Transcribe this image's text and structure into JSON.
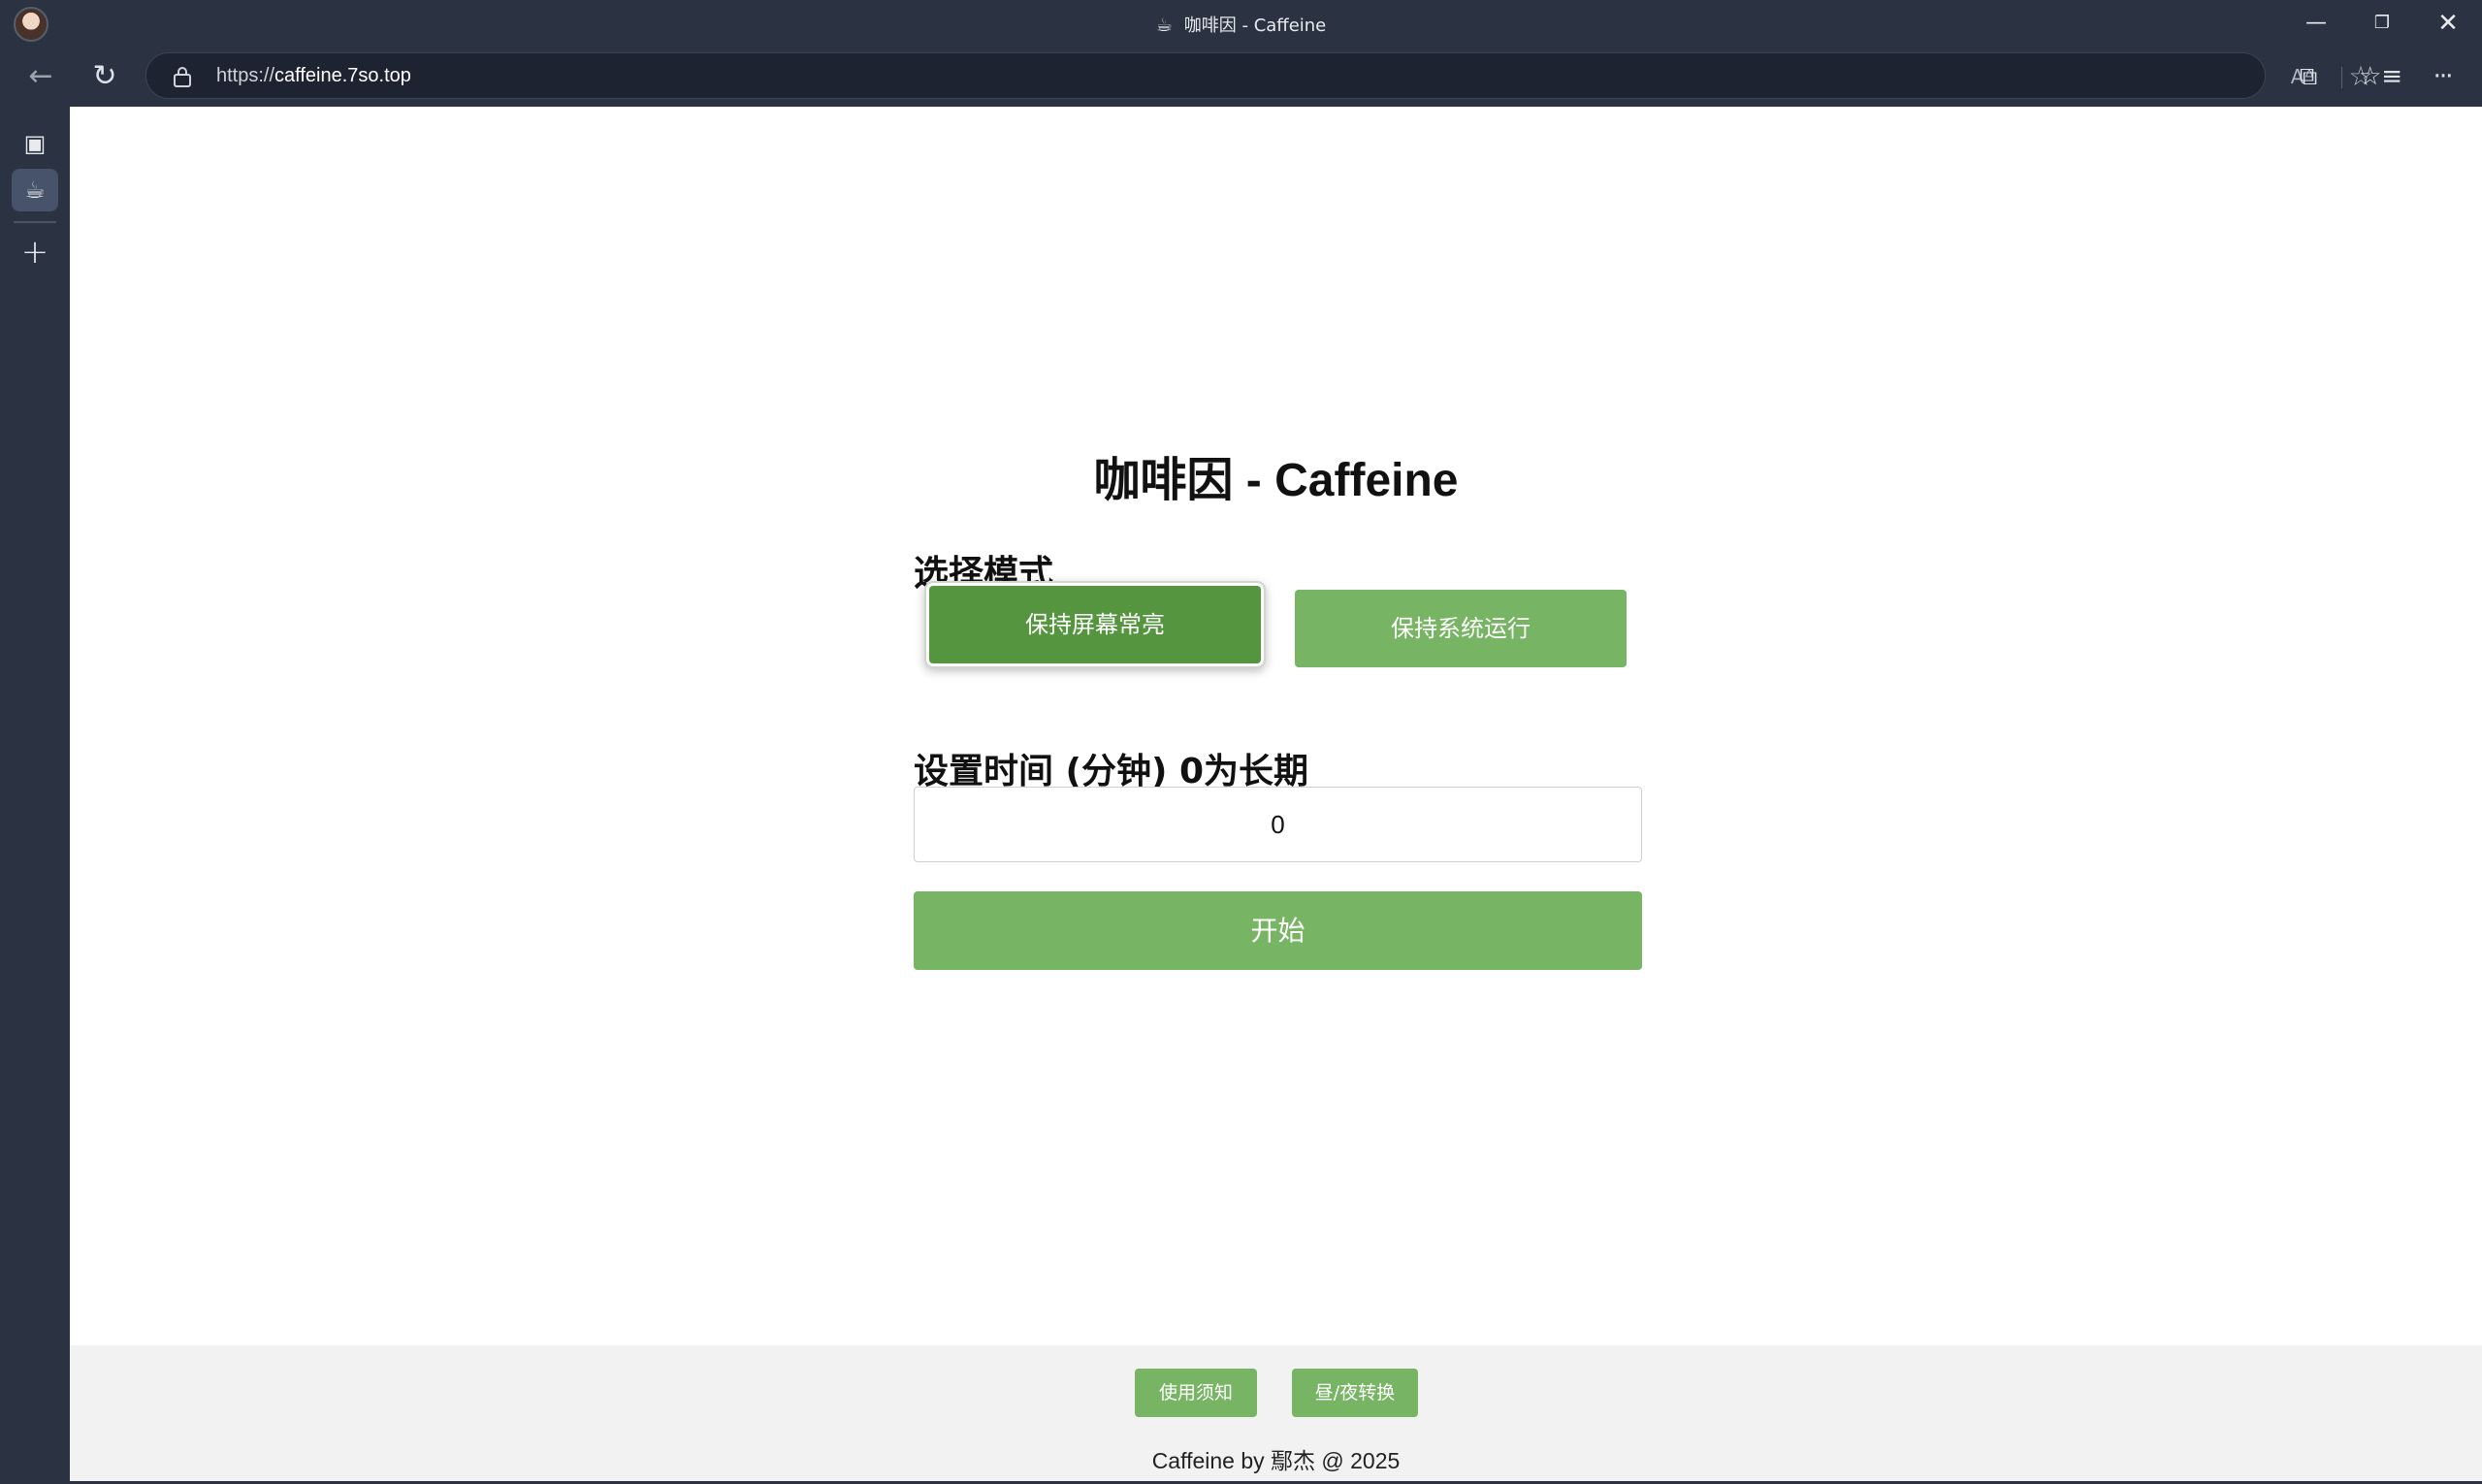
{
  "window": {
    "title": "咖啡因 - Caffeine",
    "tab_icon": "coffee-cup-icon",
    "controls": {
      "minimize": "—",
      "restore": "❐",
      "close": "✕"
    }
  },
  "toolbar": {
    "url_scheme": "https://",
    "url_host": "caffeine.7so.top",
    "icons": [
      "back-arrow-icon",
      "reload-icon",
      "lock-icon",
      "read-aloud-icon",
      "favorite-star-icon",
      "extensions-icon",
      "favorites-icon",
      "more-icon"
    ]
  },
  "sidebar": {
    "icons": [
      "tab-actions-icon",
      "coffee-tab-icon",
      "new-tab-plus-icon"
    ]
  },
  "page": {
    "title": "咖啡因 - Caffeine",
    "mode_label": "选择模式",
    "modes": [
      {
        "label": "保持屏幕常亮",
        "selected": true
      },
      {
        "label": "保持系统运行",
        "selected": false
      }
    ],
    "time_label": "设置时间 (分钟) 0为长期",
    "time_value": "0",
    "start_label": "开始"
  },
  "footer": {
    "notice_label": "使用须知",
    "daynight_label": "昼/夜转换",
    "credit": "Caffeine by 鄢杰 @ 2025"
  },
  "colors": {
    "chrome": "#2b3342",
    "accent_green": "#77b463",
    "selected_green": "#55953f",
    "footer_bg": "#f2f2f2"
  }
}
